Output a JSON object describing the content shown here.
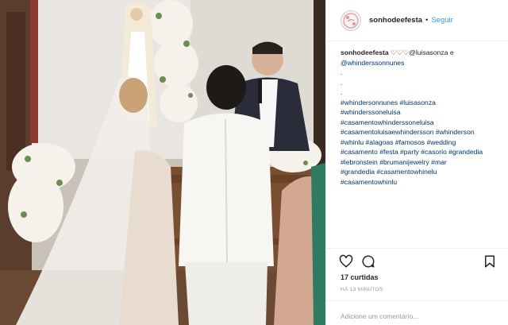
{
  "post": {
    "account": {
      "username": "sonhodeefesta",
      "separator": "•",
      "follow_label": "Seguir"
    },
    "caption": {
      "username": "sonhodeefesta",
      "text_lines": [
        "♡♡♡@luisasonza e",
        "@whinderssonnunes",
        ".",
        ".",
        ".",
        "#whindersonnunes #luisasonza",
        "#whinderssoneluisa",
        "#casamentowhinderssoneluisa",
        "#casamentoluisaewhindersson #whinderson",
        "#whinlu #alagoas #famosos #wedding",
        "#casamento #festa #party #casorio #grandedia",
        "#lebronstein #brumanijewelry #mar",
        "#grandedia #casamentowhinelu",
        "#casamentowhinlu"
      ]
    },
    "likes_text": "17 curtidas",
    "time_text": "HÁ 13 MINUTOS",
    "comment": {
      "placeholder": "Adicione um comentário...",
      "value": ""
    },
    "icons": {
      "like": "heart-icon",
      "comment": "comment-bubble-icon",
      "save": "bookmark-icon"
    },
    "colors": {
      "link_blue": "#3897f0",
      "hashtag": "#003569",
      "muted": "#999999",
      "text": "#262626"
    }
  }
}
